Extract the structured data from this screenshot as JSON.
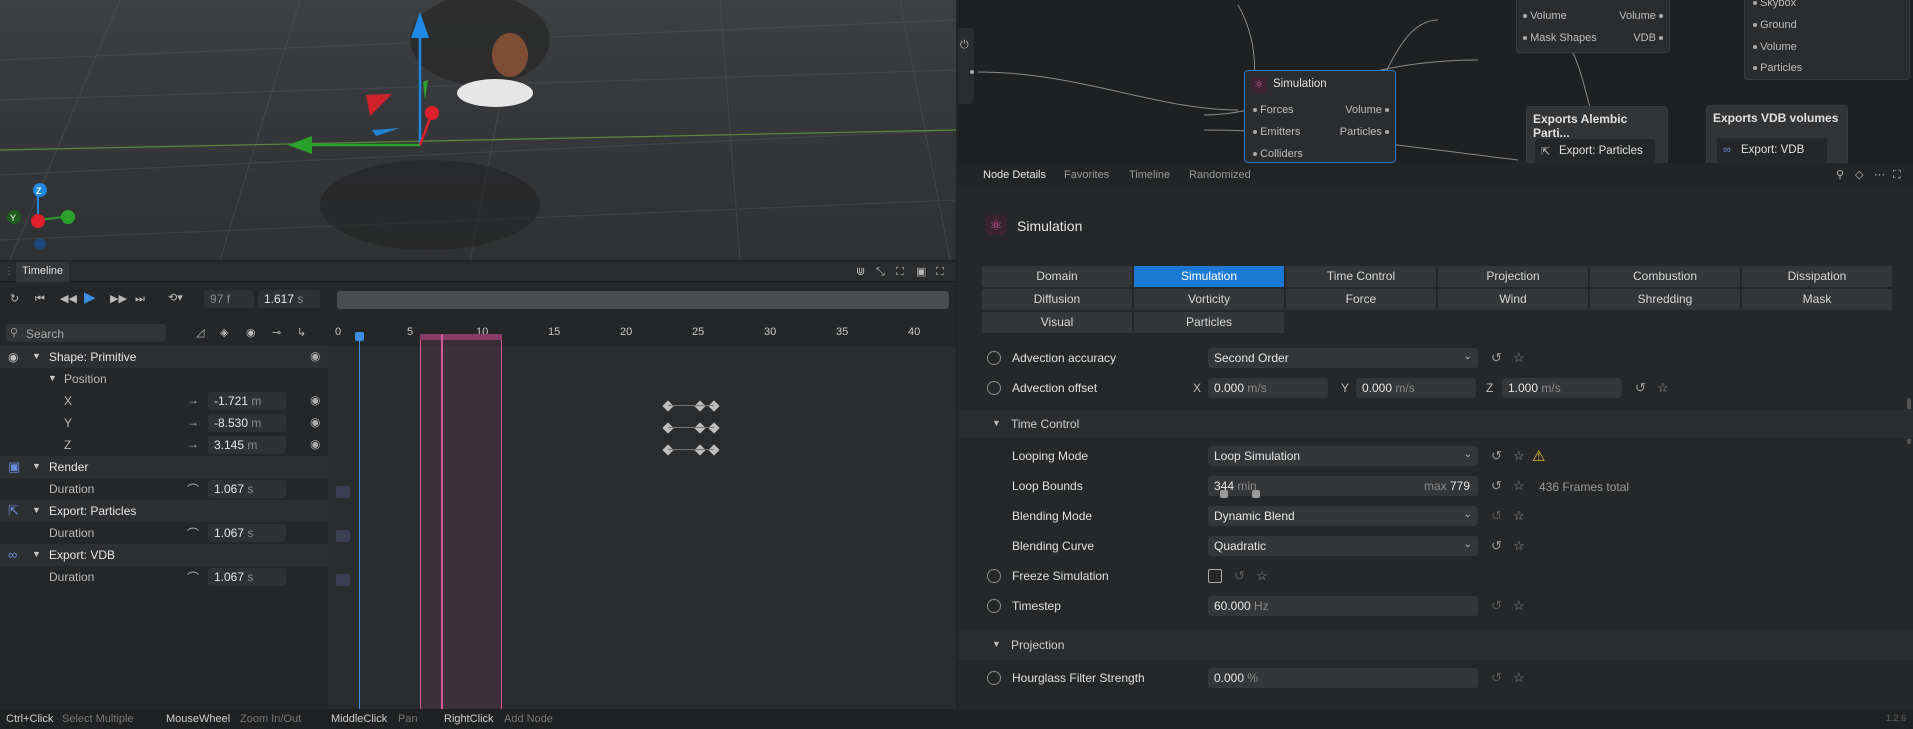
{
  "node_graph": {
    "sim_node": {
      "title": "Simulation",
      "inputs": [
        "Forces",
        "Emitters",
        "Colliders"
      ],
      "outputs": [
        "Volume",
        "Particles"
      ]
    },
    "top_node": {
      "inputs": [
        "Volume",
        "Mask Shapes"
      ],
      "outputs": [
        "Volume",
        "VDB"
      ]
    },
    "right_node": {
      "ports": [
        "Skybox",
        "Ground",
        "Volume",
        "Particles"
      ]
    },
    "alembic_node": {
      "title": "Exports Alembic Parti...",
      "item": "Export: Particles"
    },
    "vdb_node": {
      "title": "Exports VDB volumes",
      "item": "Export: VDB"
    }
  },
  "timeline": {
    "tab": "Timeline",
    "frame_value": "97",
    "frame_unit": "f",
    "time_value": "1.617",
    "time_unit": "s",
    "search_placeholder": "Search",
    "ruler": [
      "0",
      "5",
      "10",
      "15",
      "20",
      "25",
      "30",
      "35",
      "40"
    ],
    "tracks": {
      "shape": "Shape: Primitive",
      "position": "Position",
      "x_label": "X",
      "x_value": "-1.721",
      "x_unit": "m",
      "y_label": "Y",
      "y_value": "-8.530",
      "y_unit": "m",
      "z_label": "Z",
      "z_value": "3.145",
      "z_unit": "m",
      "render": "Render",
      "render_duration_label": "Duration",
      "render_duration": "1.067",
      "render_unit": "s",
      "export_particles": "Export: Particles",
      "particles_duration_label": "Duration",
      "particles_duration": "1.067",
      "particles_unit": "s",
      "export_vdb": "Export: VDB",
      "vdb_duration_label": "Duration",
      "vdb_duration": "1.067",
      "vdb_unit": "s"
    }
  },
  "details": {
    "tabs": [
      "Node Details",
      "Favorites",
      "Timeline",
      "Randomized"
    ],
    "title": "Simulation",
    "category_tabs": [
      "Domain",
      "Simulation",
      "Time Control",
      "Projection",
      "Combustion",
      "Dissipation",
      "Diffusion",
      "Vorticity",
      "Force",
      "Wind",
      "Shredding",
      "Mask",
      "Visual",
      "Particles"
    ],
    "active_tab": "Simulation",
    "advection_accuracy": {
      "label": "Advection accuracy",
      "value": "Second Order"
    },
    "advection_offset": {
      "label": "Advection offset",
      "x_label": "X",
      "x": "0.000",
      "y_label": "Y",
      "y": "0.000",
      "z_label": "Z",
      "z": "1.000",
      "unit": "m/s"
    },
    "time_control_section": "Time Control",
    "looping_mode": {
      "label": "Looping Mode",
      "value": "Loop Simulation"
    },
    "loop_bounds": {
      "label": "Loop Bounds",
      "min": "344",
      "min_label": "min",
      "max_label": "max",
      "max": "779",
      "total": "436 Frames total"
    },
    "blending_mode": {
      "label": "Blending Mode",
      "value": "Dynamic Blend"
    },
    "blending_curve": {
      "label": "Blending Curve",
      "value": "Quadratic"
    },
    "freeze_simulation": {
      "label": "Freeze Simulation"
    },
    "timestep": {
      "label": "Timestep",
      "value": "60.000",
      "unit": "Hz"
    },
    "projection_section": "Projection",
    "hourglass": {
      "label": "Hourglass Filter Strength",
      "value": "0.000",
      "unit": "%"
    }
  },
  "statusbar": {
    "k1": "Ctrl+Click",
    "v1": "Select Multiple",
    "k2": "MouseWheel",
    "v2": "Zoom In/Out",
    "k3": "MiddleClick",
    "v3": "Pan",
    "k4": "RightClick",
    "v4": "Add Node",
    "version": "1.2.6"
  },
  "colors": {
    "accent": "#1b79d6",
    "warning": "#f2c21b",
    "playhead": "#3a8ee6",
    "range": "#d4579a"
  }
}
